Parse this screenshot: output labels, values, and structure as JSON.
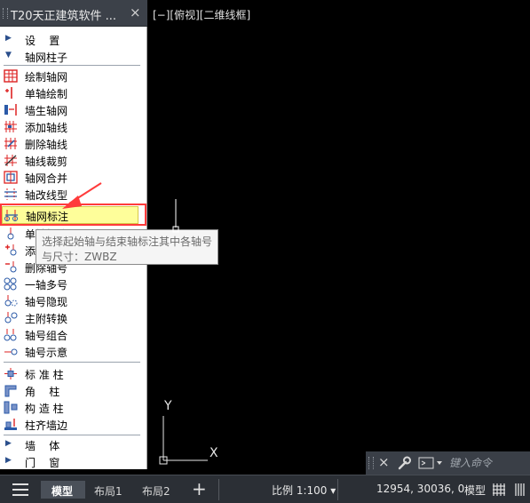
{
  "panel": {
    "title": "T20天正建筑软件 ...",
    "close_glyph": "×",
    "categories_top": [
      {
        "label": "设    置",
        "state": "collapsed"
      },
      {
        "label": "轴网柱子",
        "state": "expanded"
      }
    ],
    "items": [
      {
        "label": "绘制轴网",
        "icon": "grid-draw-icon"
      },
      {
        "label": "单轴绘制",
        "icon": "single-axis-icon"
      },
      {
        "label": "墙生轴网",
        "icon": "wall-grid-icon"
      },
      {
        "label": "添加轴线",
        "icon": "add-axis-icon"
      },
      {
        "label": "删除轴线",
        "icon": "delete-axis-icon"
      },
      {
        "label": "轴线裁剪",
        "icon": "trim-axis-icon"
      },
      {
        "label": "轴网合并",
        "icon": "merge-grid-icon"
      },
      {
        "label": "轴改线型",
        "icon": "linetype-icon"
      },
      {
        "label": "轴网标注",
        "icon": "grid-dimension-icon",
        "active": true
      },
      {
        "label": "单轴标注",
        "icon": "single-dim-icon"
      },
      {
        "label": "添加轴号",
        "icon": "add-number-icon"
      },
      {
        "label": "删除轴号",
        "icon": "delete-number-icon"
      },
      {
        "label": "一轴多号",
        "icon": "multi-number-icon"
      },
      {
        "label": "轴号隐现",
        "icon": "hide-number-icon"
      },
      {
        "label": "主附转换",
        "icon": "convert-icon"
      },
      {
        "label": "轴号组合",
        "icon": "combine-number-icon"
      },
      {
        "label": "轴号示意",
        "icon": "number-sketch-icon"
      }
    ],
    "column_items": [
      {
        "label": "标 准 柱",
        "icon": "standard-column-icon"
      },
      {
        "label": "角    柱",
        "icon": "corner-column-icon"
      },
      {
        "label": "构 造 柱",
        "icon": "structural-column-icon"
      },
      {
        "label": "柱齐墙边",
        "icon": "align-column-icon"
      }
    ],
    "categories_bottom": [
      {
        "label": "墙    体",
        "state": "collapsed"
      },
      {
        "label": "门    窗",
        "state": "collapsed"
      }
    ]
  },
  "tooltip": {
    "line1": "选择起始轴与结束轴标注其中各轴号",
    "line2": "与尺寸：ZWBZ"
  },
  "viewport": {
    "label": "[−][俯视][二维线框]",
    "ucs_x": "X",
    "ucs_y": "Y"
  },
  "command": {
    "placeholder": "键入命令",
    "close_glyph": "×"
  },
  "status": {
    "tabs": [
      {
        "label": "模型",
        "active": true
      },
      {
        "label": "布局1",
        "active": false
      },
      {
        "label": "布局2",
        "active": false
      }
    ],
    "plus": "+",
    "scale": "比例 1:100 ▾",
    "coords": "12954, 30036, 0",
    "mode": "模型"
  },
  "colors": {
    "canvas_bg": "#000000",
    "panel_bg": "#ffffff",
    "highlight": "#fefe9a",
    "callout_red": "#ff3b3b"
  }
}
